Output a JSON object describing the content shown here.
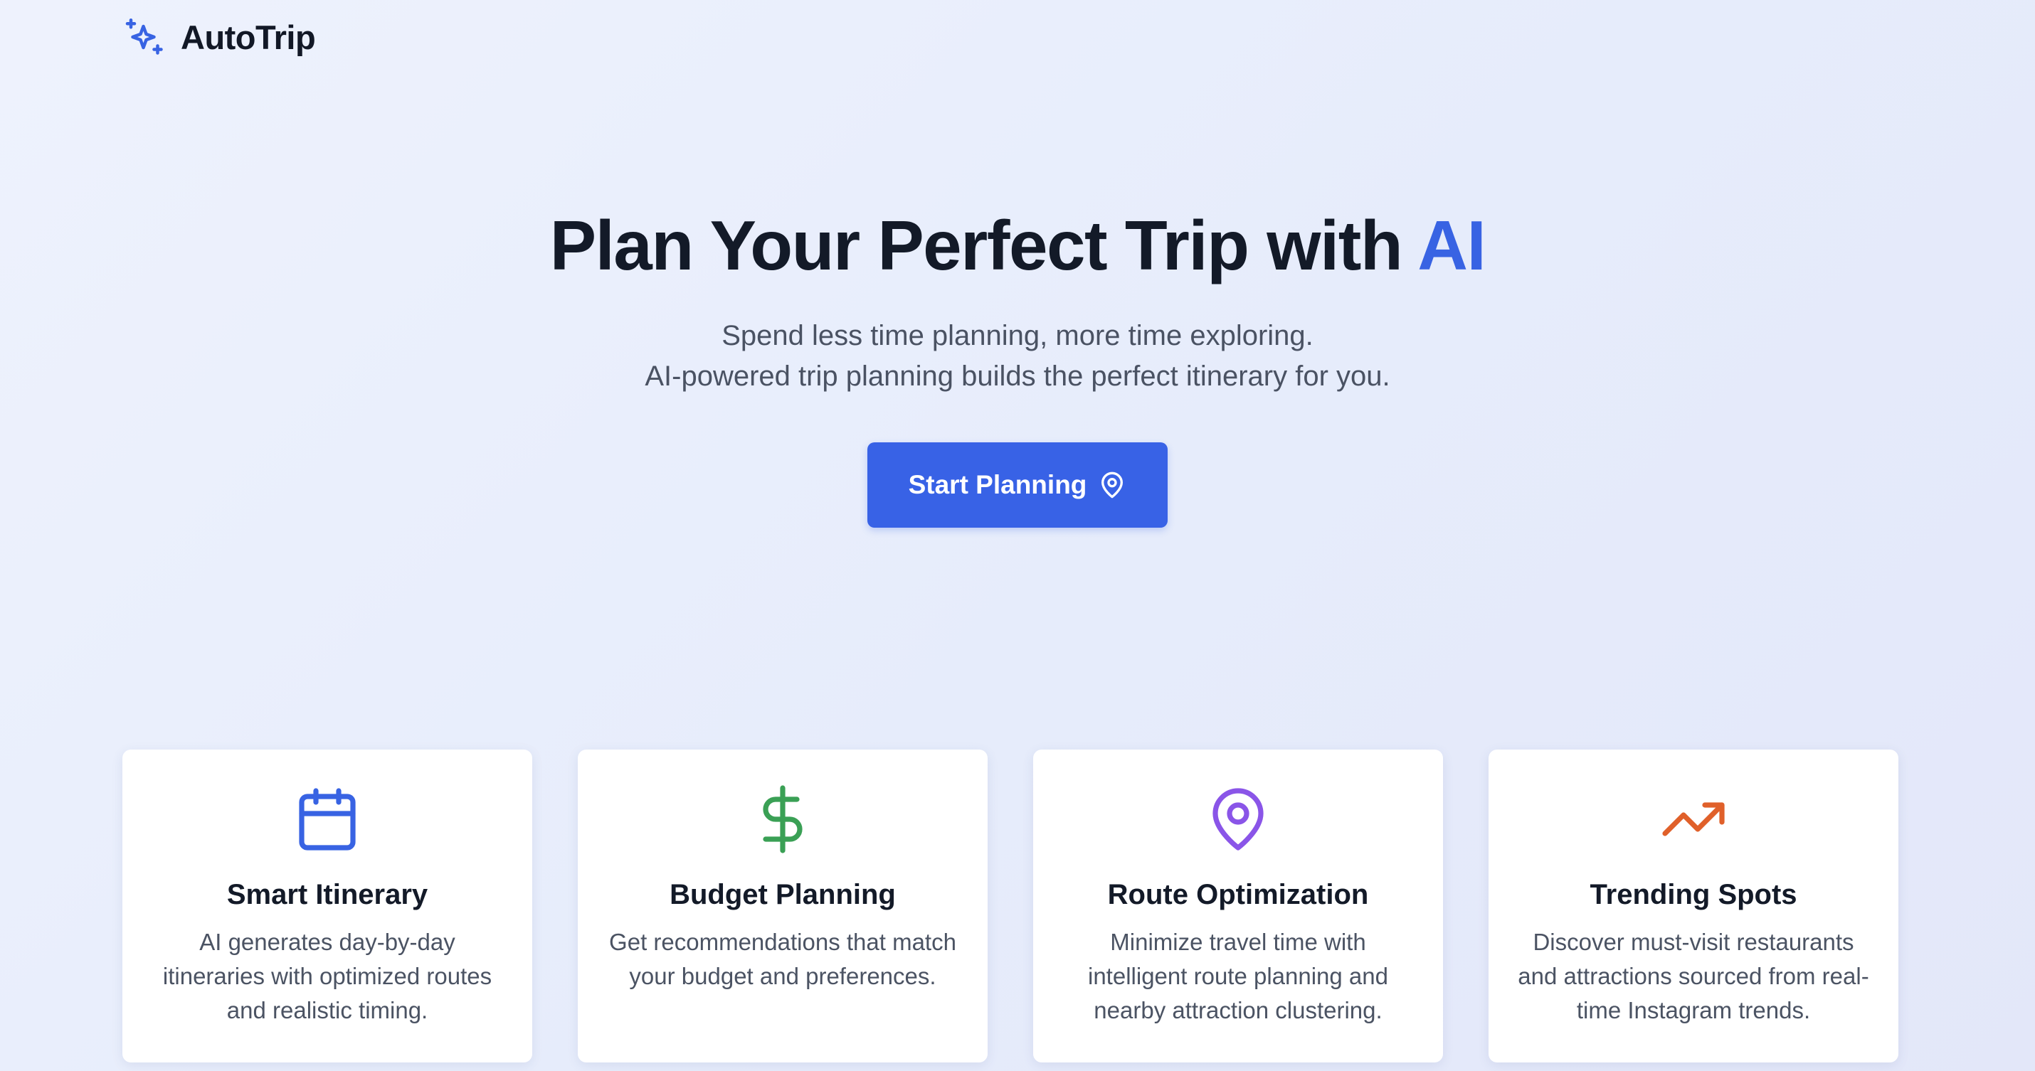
{
  "header": {
    "brand": "AutoTrip",
    "logo_icon": "sparkles-icon",
    "accent_color": "#3863e3"
  },
  "hero": {
    "title_main": "Plan Your Perfect Trip with ",
    "title_accent": "AI",
    "subtitle_line1": "Spend less time planning, more time exploring.",
    "subtitle_line2": "AI-powered trip planning builds the perfect itinerary for you.",
    "cta_label": "Start Planning",
    "cta_icon": "map-pin-icon",
    "cta_color": "#3862e6"
  },
  "features": [
    {
      "title": "Smart Itinerary",
      "description": "AI generates day-by-day itineraries with optimized routes and realistic timing.",
      "icon": "calendar-icon",
      "color": "#3863e3"
    },
    {
      "title": "Budget Planning",
      "description": "Get recommendations that match your budget and preferences.",
      "icon": "dollar-icon",
      "color": "#3aa055"
    },
    {
      "title": "Route Optimization",
      "description": "Minimize travel time with intelligent route planning and nearby attraction clustering.",
      "icon": "map-pin-icon",
      "color": "#8a55e8"
    },
    {
      "title": "Trending Spots",
      "description": "Discover must-visit restaurants and attractions sourced from real-time Instagram trends.",
      "icon": "trending-up-icon",
      "color": "#e0602a"
    }
  ]
}
